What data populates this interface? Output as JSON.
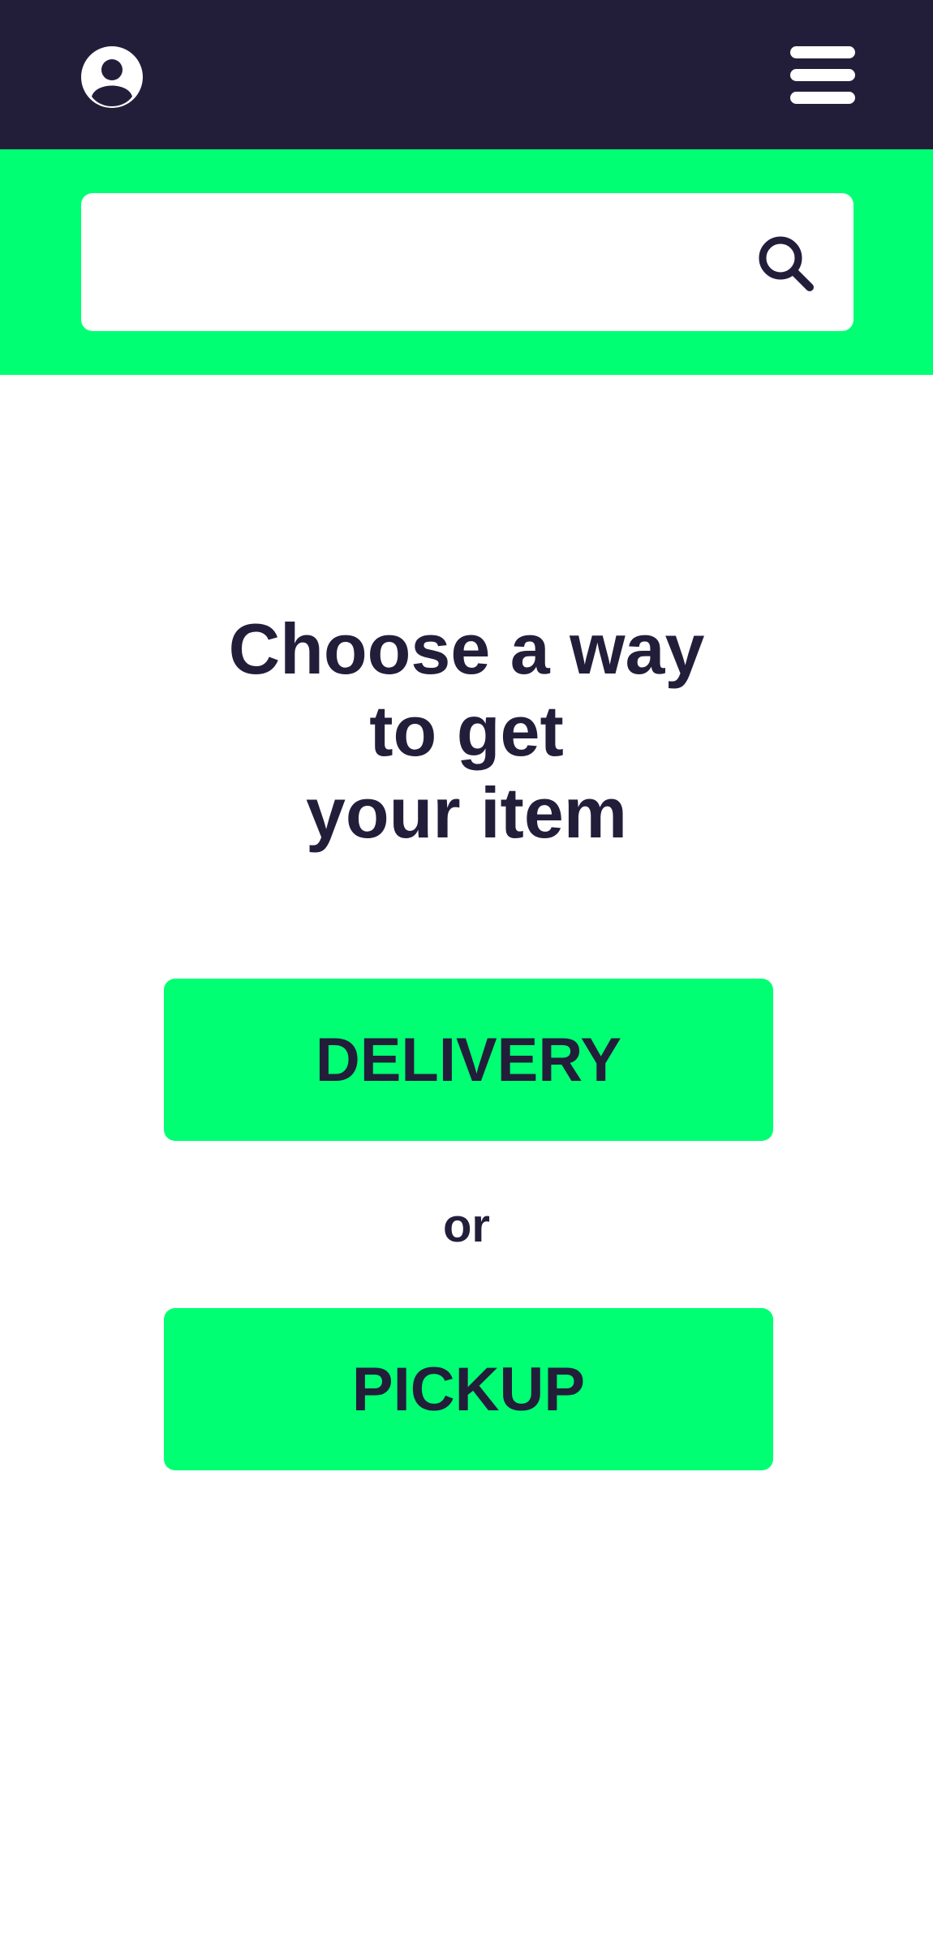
{
  "header": {
    "avatar_icon": "user-avatar-icon",
    "menu_icon": "hamburger-menu-icon"
  },
  "search": {
    "value": "",
    "placeholder": "",
    "icon": "search-icon"
  },
  "main": {
    "heading_lines": [
      "Choose a way",
      "to get",
      "your item"
    ],
    "delivery_label": "DELIVERY",
    "separator": "or",
    "pickup_label": "PICKUP"
  },
  "colors": {
    "header_bg": "#221e3a",
    "accent": "#00ff73",
    "text": "#221e3a",
    "background": "#ffffff"
  }
}
